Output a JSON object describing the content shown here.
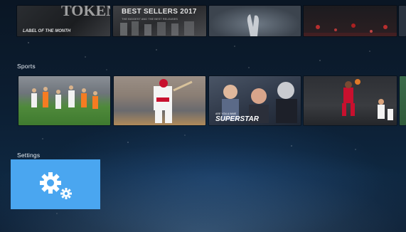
{
  "rows": [
    {
      "id": "top",
      "title": "",
      "tiles": [
        {
          "name": "label-of-the-month",
          "caption": "LABEL OF THE MONTH",
          "big": "TOKEN"
        },
        {
          "name": "best-sellers",
          "caption": "BEST SELLERS 2017",
          "sub": "THE BIGGEST AND THE BEST RELEASES"
        },
        {
          "name": "praying-hands",
          "caption": ""
        },
        {
          "name": "red-lights",
          "caption": ""
        }
      ]
    },
    {
      "id": "sports",
      "title": "Sports",
      "tiles": [
        {
          "name": "soccer-match",
          "caption": ""
        },
        {
          "name": "baseball-player",
          "caption": ""
        },
        {
          "name": "wwe-superstar",
          "caption": "SUPERSTAR",
          "sub": "ARE YOU A WWE"
        },
        {
          "name": "basketball-dunk",
          "caption": ""
        }
      ]
    },
    {
      "id": "settings",
      "title": "Settings",
      "tiles": [
        {
          "name": "settings-tile",
          "icon": "gear-icon"
        }
      ]
    }
  ],
  "colors": {
    "settings_tile": "#4aa6f0",
    "background": "#0c1e32"
  }
}
